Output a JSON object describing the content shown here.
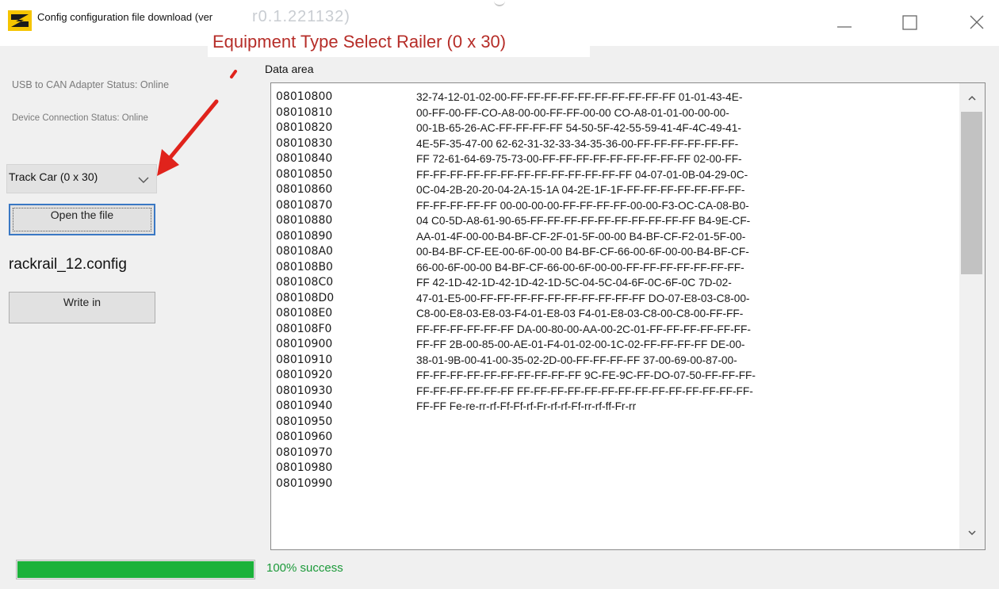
{
  "window": {
    "title": "Config configuration file download (ver",
    "title_faded": "r0.1.221132)"
  },
  "annotation": {
    "text": "Equipment Type Select Railer (0 x 30)",
    "color": "#b62d28"
  },
  "left_panel": {
    "usb_status": "USB to CAN Adapter Status: Online",
    "device_status": "Device Connection Status: Online",
    "equipment_select": {
      "value": "Track Car (0 x 30)"
    },
    "open_button": "Open the file",
    "file_name": "rackrail_12.config",
    "write_button": "Write in"
  },
  "data_area": {
    "label": "Data area",
    "addresses": [
      "08010800",
      "08010810",
      "08010820",
      "08010830",
      "08010840",
      "08010850",
      "08010860",
      "08010870",
      "08010880",
      "08010890",
      "080108A0",
      "080108B0",
      "080108C0",
      "080108D0",
      "080108E0",
      "080108F0",
      "08010900",
      "08010910",
      "08010920",
      "08010930",
      "08010940",
      "08010950",
      "08010960",
      "08010970",
      "08010980",
      "08010990"
    ],
    "hex_lines": [
      "32-74-12-01-02-00-FF-FF-FF-FF-FF-FF-FF-FF-FF-FF 01-01-43-4E-",
      "00-FF-00-FF-CO-A8-00-00-FF-FF-00-00 CO-A8-01-01-00-00-00-",
      "00-1B-65-26-AC-FF-FF-FF-FF 54-50-5F-42-55-59-41-4F-4C-49-41-",
      "4E-5F-35-47-00 62-62-31-32-33-34-35-36-00-FF-FF-FF-FF-FF-FF-",
      "FF 72-61-64-69-75-73-00-FF-FF-FF-FF-FF-FF-FF-FF-FF 02-00-FF-",
      "FF-FF-FF-FF-FF-FF-FF-FF-FF-FF-FF-FF-FF 04-07-01-0B-04-29-0C-",
      "0C-04-2B-20-20-04-2A-15-1A 04-2E-1F-1F-FF-FF-FF-FF-FF-FF-FF-",
      "FF-FF-FF-FF-FF 00-00-00-00-FF-FF-FF-FF-00-00-F3-OC-CA-08-B0-",
      "04 C0-5D-A8-61-90-65-FF-FF-FF-FF-FF-FF-FF-FF-FF-FF B4-9E-CF-",
      "AA-01-4F-00-00-B4-BF-CF-2F-01-5F-00-00 B4-BF-CF-F2-01-5F-00-",
      "00-B4-BF-CF-EE-00-6F-00-00 B4-BF-CF-66-00-6F-00-00-B4-BF-CF-",
      "66-00-6F-00-00 B4-BF-CF-66-00-6F-00-00-FF-FF-FF-FF-FF-FF-FF-",
      "FF 42-1D-42-1D-42-1D-42-1D-5C-04-5C-04-6F-0C-6F-0C 7D-02-",
      "47-01-E5-00-FF-FF-FF-FF-FF-FF-FF-FF-FF-FF DO-07-E8-03-C8-00-",
      "C8-00-E8-03-E8-03-F4-01-E8-03 F4-01-E8-03-C8-00-C8-00-FF-FF-",
      "FF-FF-FF-FF-FF-FF DA-00-80-00-AA-00-2C-01-FF-FF-FF-FF-FF-FF-",
      "FF-FF 2B-00-85-00-AE-01-F4-01-02-00-1C-02-FF-FF-FF-FF DE-00-",
      "38-01-9B-00-41-00-35-02-2D-00-FF-FF-FF-FF 37-00-69-00-87-00-",
      "FF-FF-FF-FF-FF-FF-FF-FF-FF-FF 9C-FE-9C-FF-DO-07-50-FF-FF-FF-",
      "FF-FF-FF-FF-FF-FF FF-FF-FF-FF-FF-FF-FF-FF-FF-FF-FF-FF-FF-FF-",
      "FF-FF Fe-re-rr-rf-Ff-Ff-rf-Fr-rf-rf-Ff-rr-rf-ff-Fr-rr"
    ]
  },
  "progress": {
    "percent": 100,
    "label": "100% success",
    "color": "#1bb23a"
  }
}
